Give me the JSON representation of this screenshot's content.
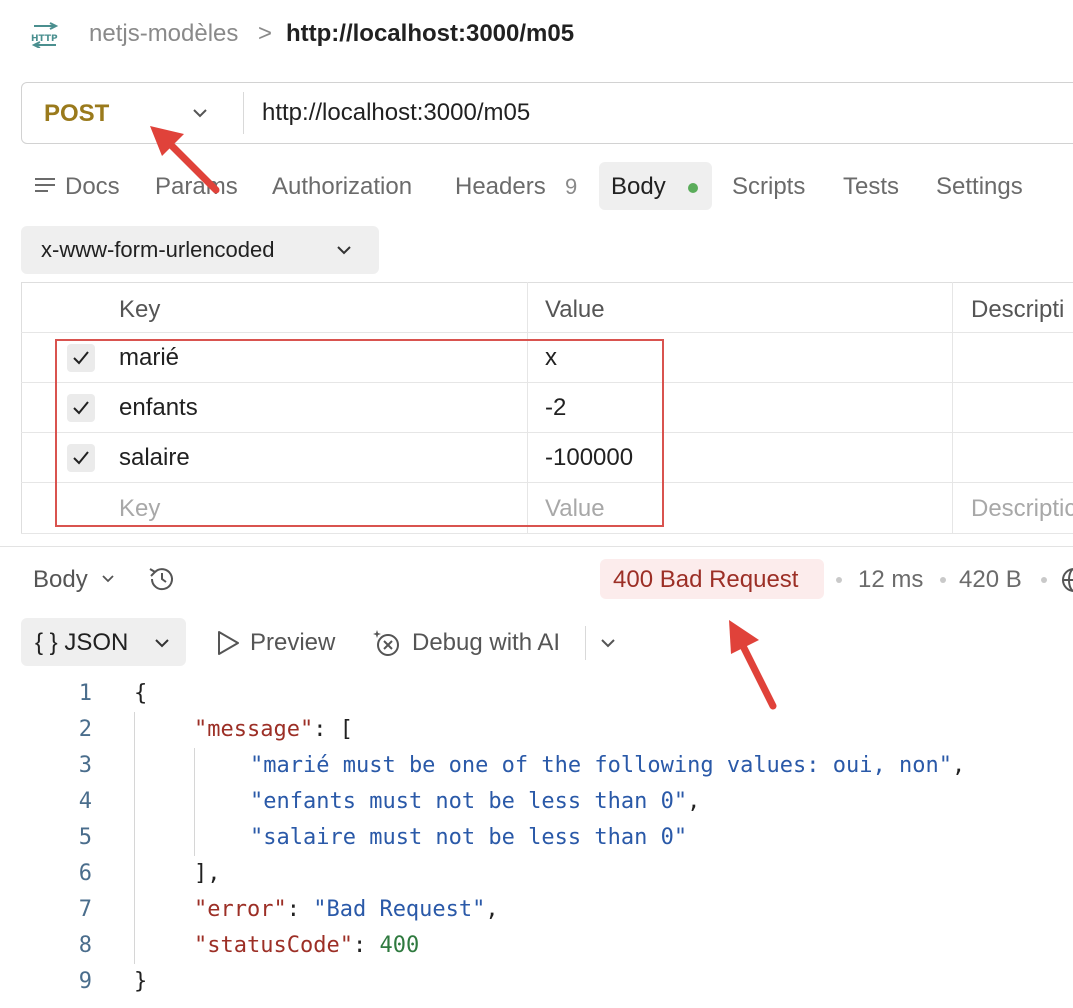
{
  "breadcrumb": {
    "icon": "http-icon",
    "parent": "netjs-modèles",
    "separator": ">",
    "current": "http://localhost:3000/m05"
  },
  "request": {
    "method": "POST",
    "method_color": "#9a7a1c",
    "url": "http://localhost:3000/m05"
  },
  "tabs": {
    "docs": "Docs",
    "params": "Params",
    "authorization": "Authorization",
    "headers": "Headers",
    "headers_count": "9",
    "body": "Body",
    "scripts": "Scripts",
    "tests": "Tests",
    "settings": "Settings"
  },
  "body_mode": "x-www-form-urlencoded",
  "table": {
    "headers": {
      "key": "Key",
      "value": "Value",
      "description": "Descripti"
    },
    "rows": [
      {
        "checked": true,
        "key": "marié",
        "value": "x"
      },
      {
        "checked": true,
        "key": "enfants",
        "value": "-2"
      },
      {
        "checked": true,
        "key": "salaire",
        "value": "-100000"
      }
    ],
    "new_row": {
      "key_placeholder": "Key",
      "value_placeholder": "Value",
      "description_placeholder": "Descriptic"
    }
  },
  "response": {
    "body_dropdown": "Body",
    "status": "400 Bad Request",
    "status_color": "#9c2f26",
    "time": "12 ms",
    "size": "420 B",
    "format": "JSON",
    "format_icon": "{ }",
    "preview": "Preview",
    "debug": "Debug with AI"
  },
  "code": {
    "line_numbers": [
      "1",
      "2",
      "3",
      "4",
      "5",
      "6",
      "7",
      "8",
      "9"
    ],
    "open_brace": "{",
    "message_key": "\"message\"",
    "message_after": ": [",
    "msg1": "\"marié must be one of the following values: oui, non\"",
    "msg2": "\"enfants must not be less than 0\"",
    "msg3": "\"salaire must not be less than 0\"",
    "close_bracket": "],",
    "error_key": "\"error\"",
    "error_value": "\"Bad Request\"",
    "status_key": "\"statusCode\"",
    "status_value": "400",
    "close_brace": "}",
    "colon": ": ",
    "comma": ","
  },
  "annotation_color": "#e0423a"
}
